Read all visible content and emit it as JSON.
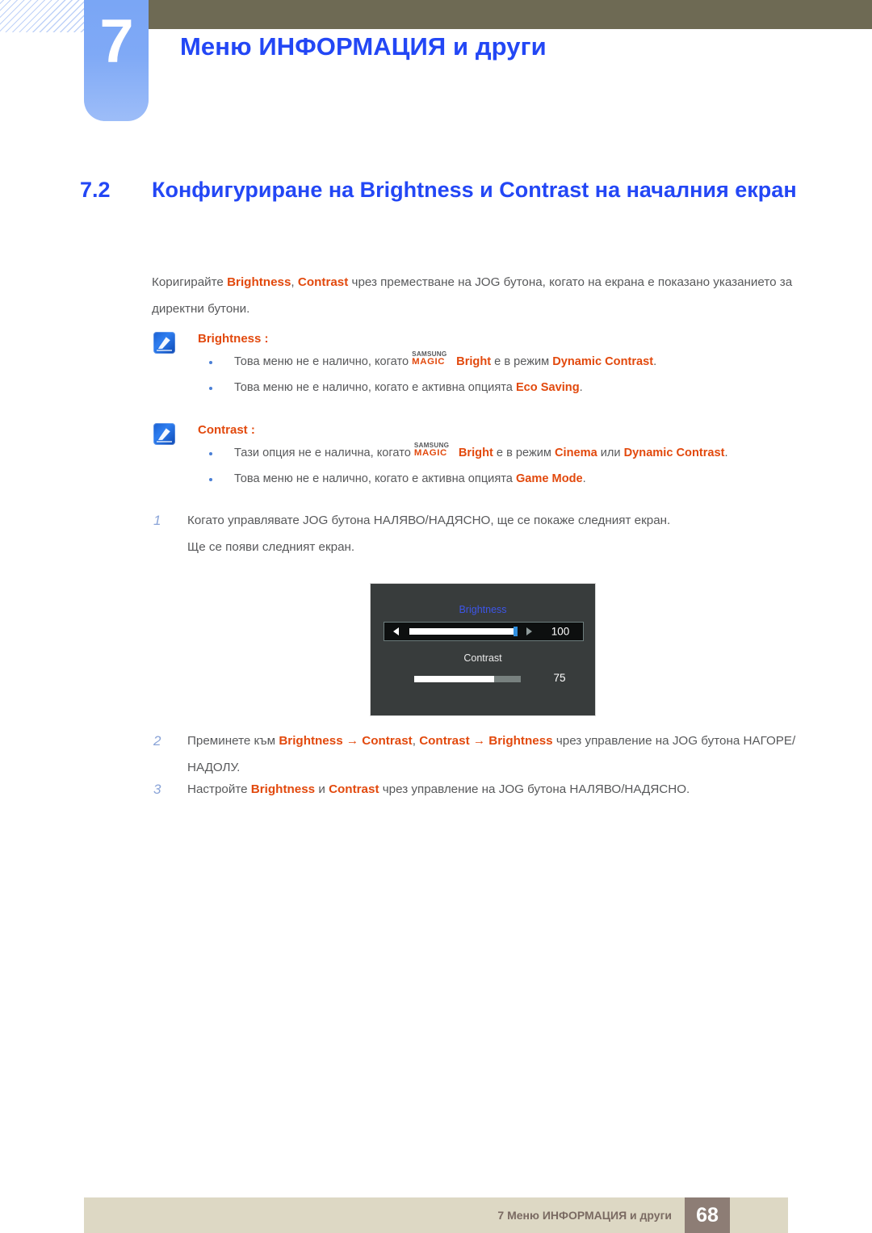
{
  "header": {
    "chapter_number": "7",
    "chapter_title": "Меню ИНФОРМАЦИЯ и други",
    "accent_color": "#2347f5",
    "bar_color": "#6e6a54"
  },
  "section": {
    "number": "7.2",
    "title": "Конфигуриране на Brightness и Contrast на началния екран"
  },
  "intro": {
    "part1": "Коригирайте ",
    "bold1": "Brightness",
    "sep1": ", ",
    "bold2": "Contrast",
    "part2": " чрез преместване на JOG бутона, когато на екрана е показано указанието за директни бутони."
  },
  "notes": [
    {
      "icon": "note-pen-icon",
      "heading": "Brightness :",
      "bullets": [
        {
          "pre": "Това меню не е налично, когато ",
          "magic_top": "SAMSUNG",
          "magic_bottom": "MAGIC",
          "magic_word": "Bright",
          "mid": " е в режим ",
          "highlight": "Dynamic Contrast",
          "post": "."
        },
        {
          "pre": "Това меню не е налично, когато е активна опцията ",
          "highlight": "Eco Saving",
          "post": "."
        }
      ]
    },
    {
      "icon": "note-pen-icon",
      "heading": "Contrast :",
      "bullets": [
        {
          "pre": "Тази опция не е налична, когато ",
          "magic_top": "SAMSUNG",
          "magic_bottom": "MAGIC",
          "magic_word": "Bright",
          "mid": " е в режим ",
          "highlight": "Cinema",
          "mid2": " или ",
          "highlight2": "Dynamic Contrast",
          "post": "."
        },
        {
          "pre": "Това меню не е налично, когато е активна опцията ",
          "highlight": "Game Mode",
          "post": "."
        }
      ]
    }
  ],
  "steps": {
    "one": {
      "num": "1",
      "line1": "Когато управлявате JOG бутона НАЛЯВО/НАДЯСНО, ще се покаже следният екран.",
      "line2": "Ще се появи следният екран."
    },
    "two": {
      "num": "2",
      "pre": "Преминете към ",
      "b1": "Brightness",
      "arrow1": " → ",
      "b2": "Contrast",
      "sep": ", ",
      "b3": "Contrast",
      "arrow2": " → ",
      "b4": "Brightness",
      "post": " чрез управление на JOG бутона НАГОРЕ/НАДОЛУ."
    },
    "three": {
      "num": "3",
      "pre": "Настройте ",
      "b1": "Brightness",
      "mid": " и ",
      "b2": "Contrast",
      "post": " чрез управление на JOG бутона НАЛЯВО/НАДЯСНО."
    }
  },
  "osd": {
    "background": "#383c3c",
    "brightness_label": "Brightness",
    "brightness_label_color": "#3d55e8",
    "brightness_value": "100",
    "contrast_label": "Contrast",
    "contrast_value": "75",
    "left_arrow_icon": "triangle-left-icon",
    "right_arrow_icon": "triangle-right-icon"
  },
  "footer": {
    "text": "7 Меню ИНФОРМАЦИЯ и други",
    "page": "68",
    "bar_color": "#ddd8c4",
    "page_color": "#8d7d75"
  }
}
